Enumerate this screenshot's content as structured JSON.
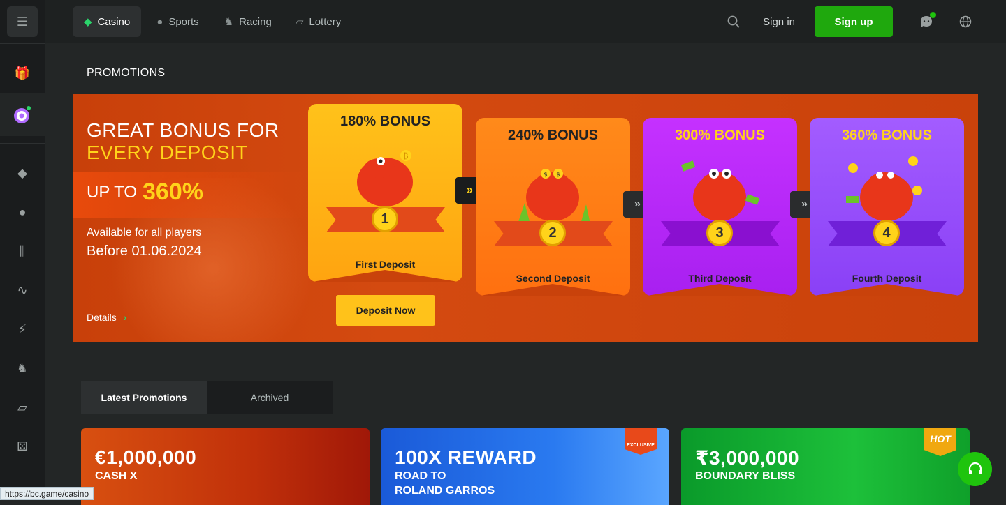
{
  "header": {
    "nav": [
      {
        "label": "Casino",
        "icon": "casino-icon",
        "active": true
      },
      {
        "label": "Sports",
        "icon": "sports-icon",
        "active": false
      },
      {
        "label": "Racing",
        "icon": "racing-icon",
        "active": false
      },
      {
        "label": "Lottery",
        "icon": "lottery-icon",
        "active": false
      }
    ],
    "signin": "Sign in",
    "signup": "Sign up"
  },
  "sidebar": {
    "icons": [
      "menu-icon",
      "gift-icon",
      "spin-wheel-icon",
      "casino-icon",
      "basketball-icon",
      "candlestick-icon",
      "pulse-icon",
      "lightning-icon",
      "horse-icon",
      "ticket-icon",
      "dice-icon"
    ]
  },
  "page": {
    "title": "PROMOTIONS"
  },
  "banner": {
    "title_line1": "GREAT BONUS FOR",
    "title_line2": "EVERY DEPOSIT",
    "upto_label": "UP TO",
    "upto_value": "360%",
    "available": "Available for all players",
    "before": "Before 01.06.2024",
    "details": "Details",
    "deposit_button": "Deposit Now",
    "cards": [
      {
        "title": "180% BONUS",
        "number": "1",
        "label": "First Deposit"
      },
      {
        "title": "240% BONUS",
        "number": "2",
        "label": "Second Deposit"
      },
      {
        "title": "300% BONUS",
        "number": "3",
        "label": "Third Deposit"
      },
      {
        "title": "360% BONUS",
        "number": "4",
        "label": "Fourth Deposit"
      }
    ]
  },
  "tabs": [
    {
      "label": "Latest Promotions",
      "active": true
    },
    {
      "label": "Archived",
      "active": false
    }
  ],
  "promos": [
    {
      "title": "€1,000,000",
      "subtitle": "CASH X"
    },
    {
      "title": "100X REWARD",
      "subtitle": "ROAD TO\nROLAND GARROS",
      "badge": "EXCLUSIVE"
    },
    {
      "title": "₹3,000,000",
      "subtitle": "BOUNDARY BLISS",
      "badge": "HOT"
    }
  ],
  "statusbar": "https://bc.game/casino",
  "colors": {
    "accent_green": "#1fa80d",
    "banner_orange": "#c9420b",
    "yellow": "#ffd31a"
  }
}
